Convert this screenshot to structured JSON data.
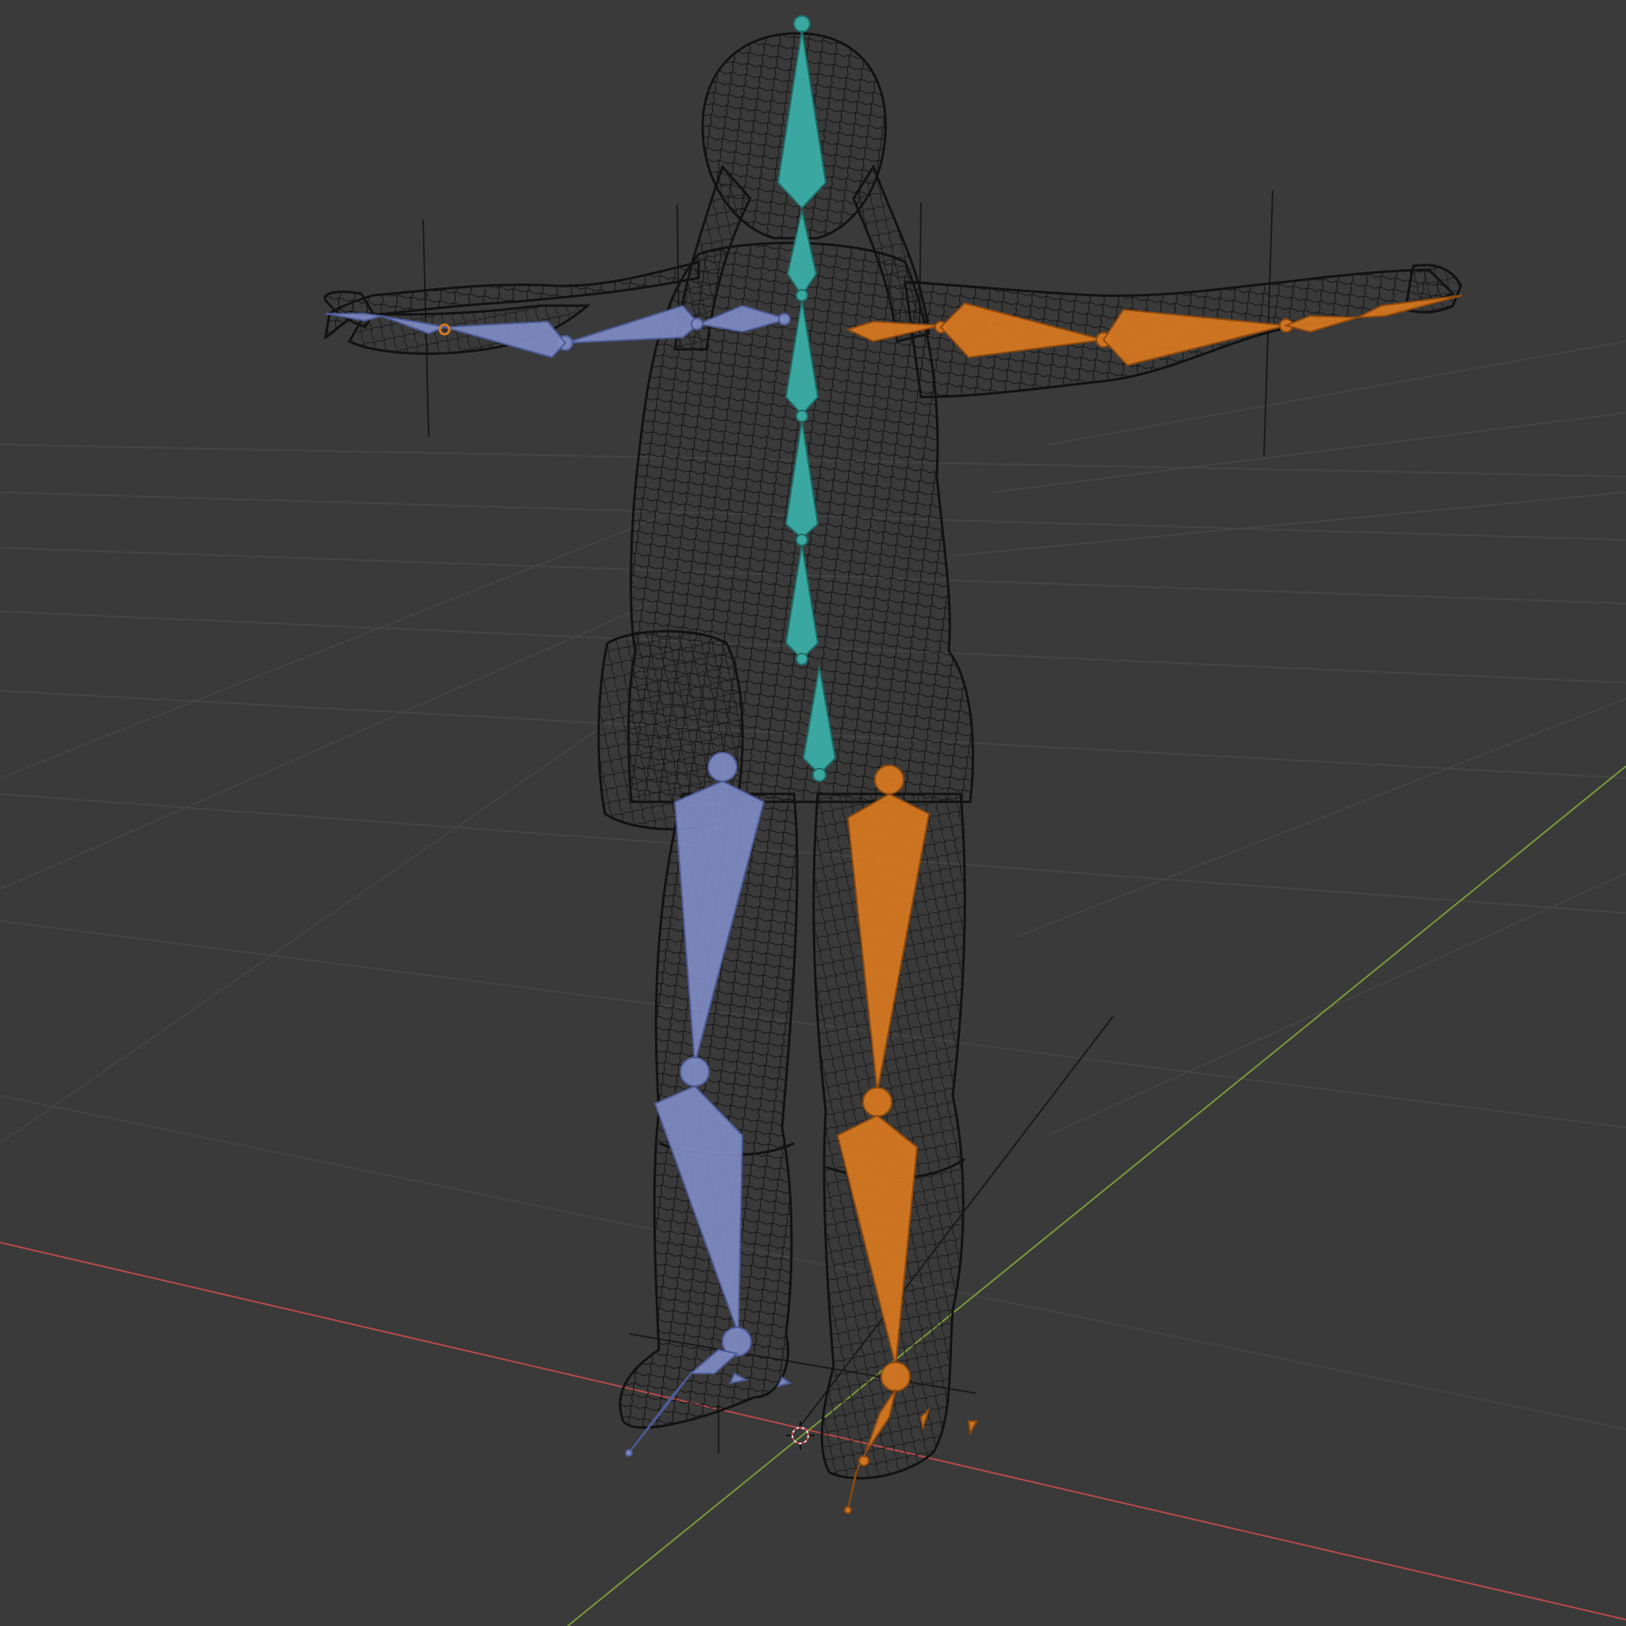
{
  "viewport": {
    "background": "#3a3a3a",
    "grid_color": "#474747",
    "x_axis_color": "#b84a4a",
    "y_axis_color": "#7a9a3a",
    "wireframe_color": "#141414",
    "bone_colors": {
      "spine": "#3aa8a0",
      "left_side": "#7f8cc4",
      "right_side": "#d97a1f"
    },
    "icons": {
      "cursor": "3d-cursor-icon",
      "light": "light-object-icon"
    }
  }
}
